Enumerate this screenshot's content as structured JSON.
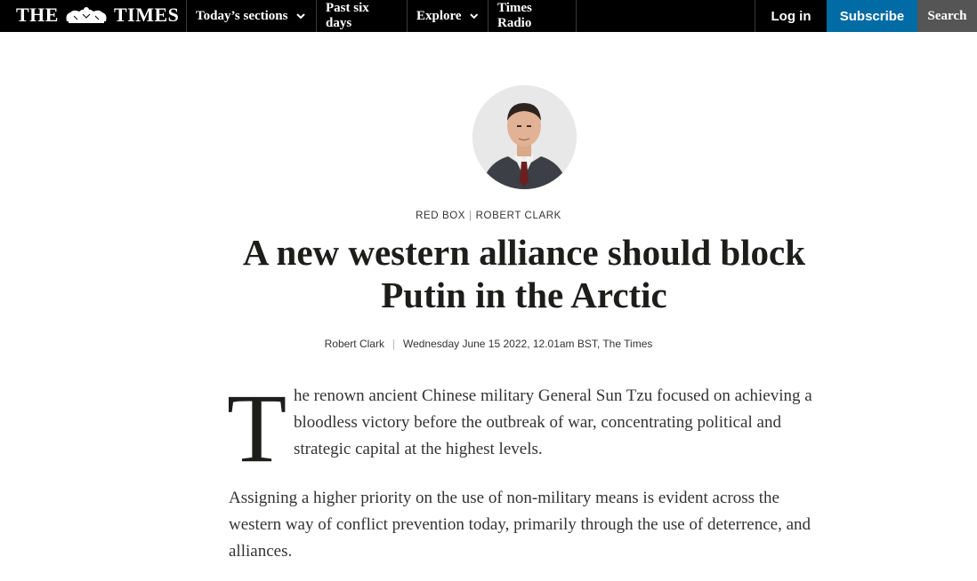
{
  "header": {
    "logo_left": "THE",
    "logo_right": "TIMES",
    "nav": [
      {
        "label": "Today’s sections",
        "has_dropdown": true
      },
      {
        "label": "Past six days",
        "has_dropdown": false
      },
      {
        "label": "Explore",
        "has_dropdown": true
      },
      {
        "label": "Times Radio",
        "has_dropdown": false
      }
    ],
    "login_label": "Log in",
    "subscribe_label": "Subscribe",
    "search_label": "Search"
  },
  "article": {
    "kicker_section": "RED BOX",
    "kicker_author": "ROBERT CLARK",
    "headline": "A new western alliance should block Putin in the Arctic",
    "byline_author": "Robert Clark",
    "byline_meta": "Wednesday June 15 2022, 12.01am BST, The Times",
    "dropcap": "T",
    "para1_rest": "he renown ancient Chinese military General Sun Tzu focused on achieving a bloodless victory before the outbreak of war, concentrating political and strategic capital at the highest levels.",
    "para2": "Assigning a higher priority on the use of non-military means is evident across the western way of conflict prevention today, primarily through the use of deterrence, and alliances."
  },
  "colors": {
    "topbar": "#000000",
    "subscribe_bg": "#006ba4",
    "search_bg": "#555555"
  },
  "icons": [
    "crest-icon",
    "chevron-down-icon",
    "author-avatar"
  ]
}
